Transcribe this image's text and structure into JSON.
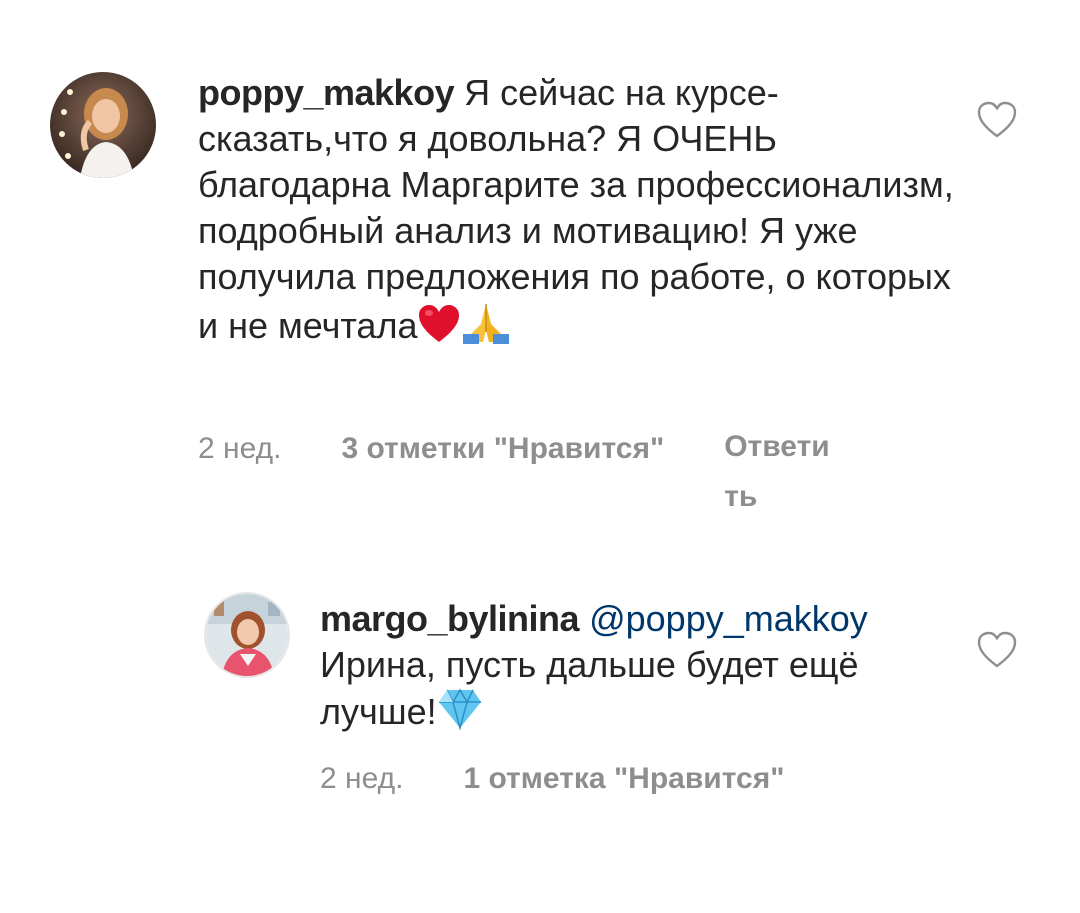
{
  "comments": [
    {
      "username": "poppy_makkoy",
      "text": "Я сейчас на курсе- сказать,что я довольна? Я ОЧЕНЬ благодарна Маргарите за профессионализм, подробный анализ и мотивацию! Я уже получила предложения по работе, о которых и не мечтала",
      "emojis": [
        "red-heart",
        "folded-hands"
      ],
      "time": "2 нед.",
      "likes": "3 отметки \"Нравится\"",
      "reply": "Ответить",
      "avatar": "avatar-poppy",
      "like_icon": "heart-outline-icon"
    },
    {
      "username": "margo_bylinina",
      "mention": "@poppy_makkoy",
      "text": "Ирина, пусть дальше будет ещё лучше!",
      "emojis": [
        "gem-stone"
      ],
      "time": "2 нед.",
      "likes": "1 отметка \"Нравится\"",
      "avatar": "avatar-margo",
      "like_icon": "heart-outline-icon"
    }
  ],
  "colors": {
    "text": "#262626",
    "meta": "#8e8e8e",
    "mention": "#00376b",
    "heart_emoji": "#e0102c",
    "background": "#ffffff"
  }
}
